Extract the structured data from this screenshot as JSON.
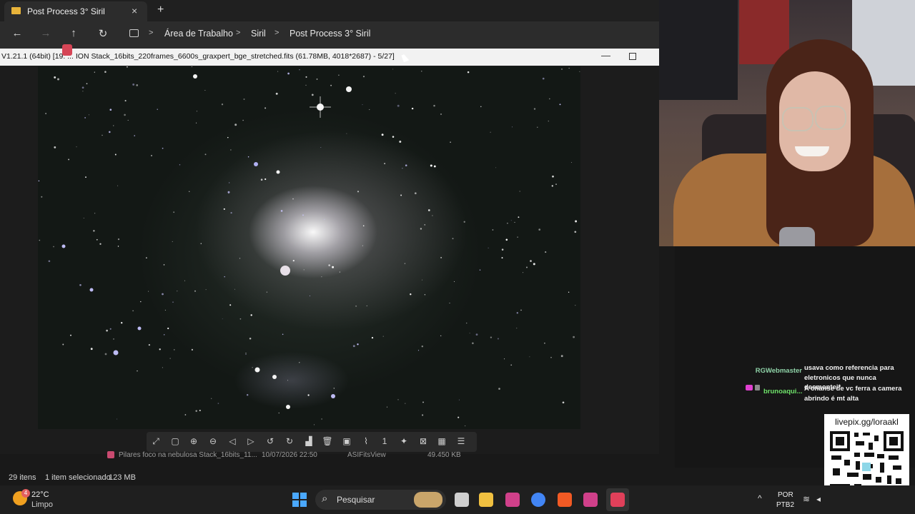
{
  "explorer": {
    "tab_title": "Post Process 3° Siril",
    "tab_close": "×",
    "new_tab": "+",
    "nav": {
      "back": "←",
      "forward": "→",
      "up": "↑",
      "refresh": "↻"
    },
    "breadcrumbs": [
      "Área de Trabalho",
      "Siril",
      "Post Process 3° Siril"
    ],
    "separator": ">",
    "file_row": {
      "name": "Pilares foco na nebulosa Stack_16bits_11...",
      "date": "10/07/2026 22:50",
      "type": "ASIFitsView",
      "size": "49.450 KB"
    },
    "status": {
      "items": "29 itens",
      "selected": "1 item selecionado",
      "size": "123 MB"
    }
  },
  "viewer": {
    "title": "V1.21.1 (64bit) [19. ... ION Stack_16bits_220frames_6600s_graxpert_bge_stretched.fits (61.78MB, 4018*2687) - 5/27]",
    "minimize": "—",
    "toolbar": [
      "fit-icon",
      "fullscreen-icon",
      "zoom-in-icon",
      "zoom-out-icon",
      "prev-icon",
      "next-icon",
      "rotate-left-icon",
      "rotate-right-icon",
      "histogram-icon",
      "delete-icon",
      "save-icon",
      "stretch-icon",
      "one-to-one-icon",
      "star-icon",
      "crop-icon",
      "grid-icon",
      "menu-icon"
    ],
    "toolbar_glyphs": [
      "⤢",
      "▢",
      "⊕",
      "⊖",
      "◁",
      "▷",
      "↺",
      "↻",
      "▟",
      "🗑",
      "▣",
      "⌇",
      "1",
      "✦",
      "⊠",
      "▦",
      "☰"
    ]
  },
  "chat": [
    {
      "name": "RGWebmaster",
      "name_color": "#8fd3a8",
      "text": "usava como referencia para eletronicos que nunca desmontei*"
    },
    {
      "name": "brunoaqui...",
      "name_color": "#6fe36a",
      "text": "A chanse de vc ferra a camera abrindo é mt alta"
    }
  ],
  "qr": {
    "label": "livepix.gg/loraakl"
  },
  "taskbar": {
    "weather_temp": "22°C",
    "weather_desc": "Limpo",
    "weather_badge": "4",
    "search_placeholder": "Pesquisar",
    "lang_top": "POR",
    "lang_bottom": "PTB2"
  }
}
